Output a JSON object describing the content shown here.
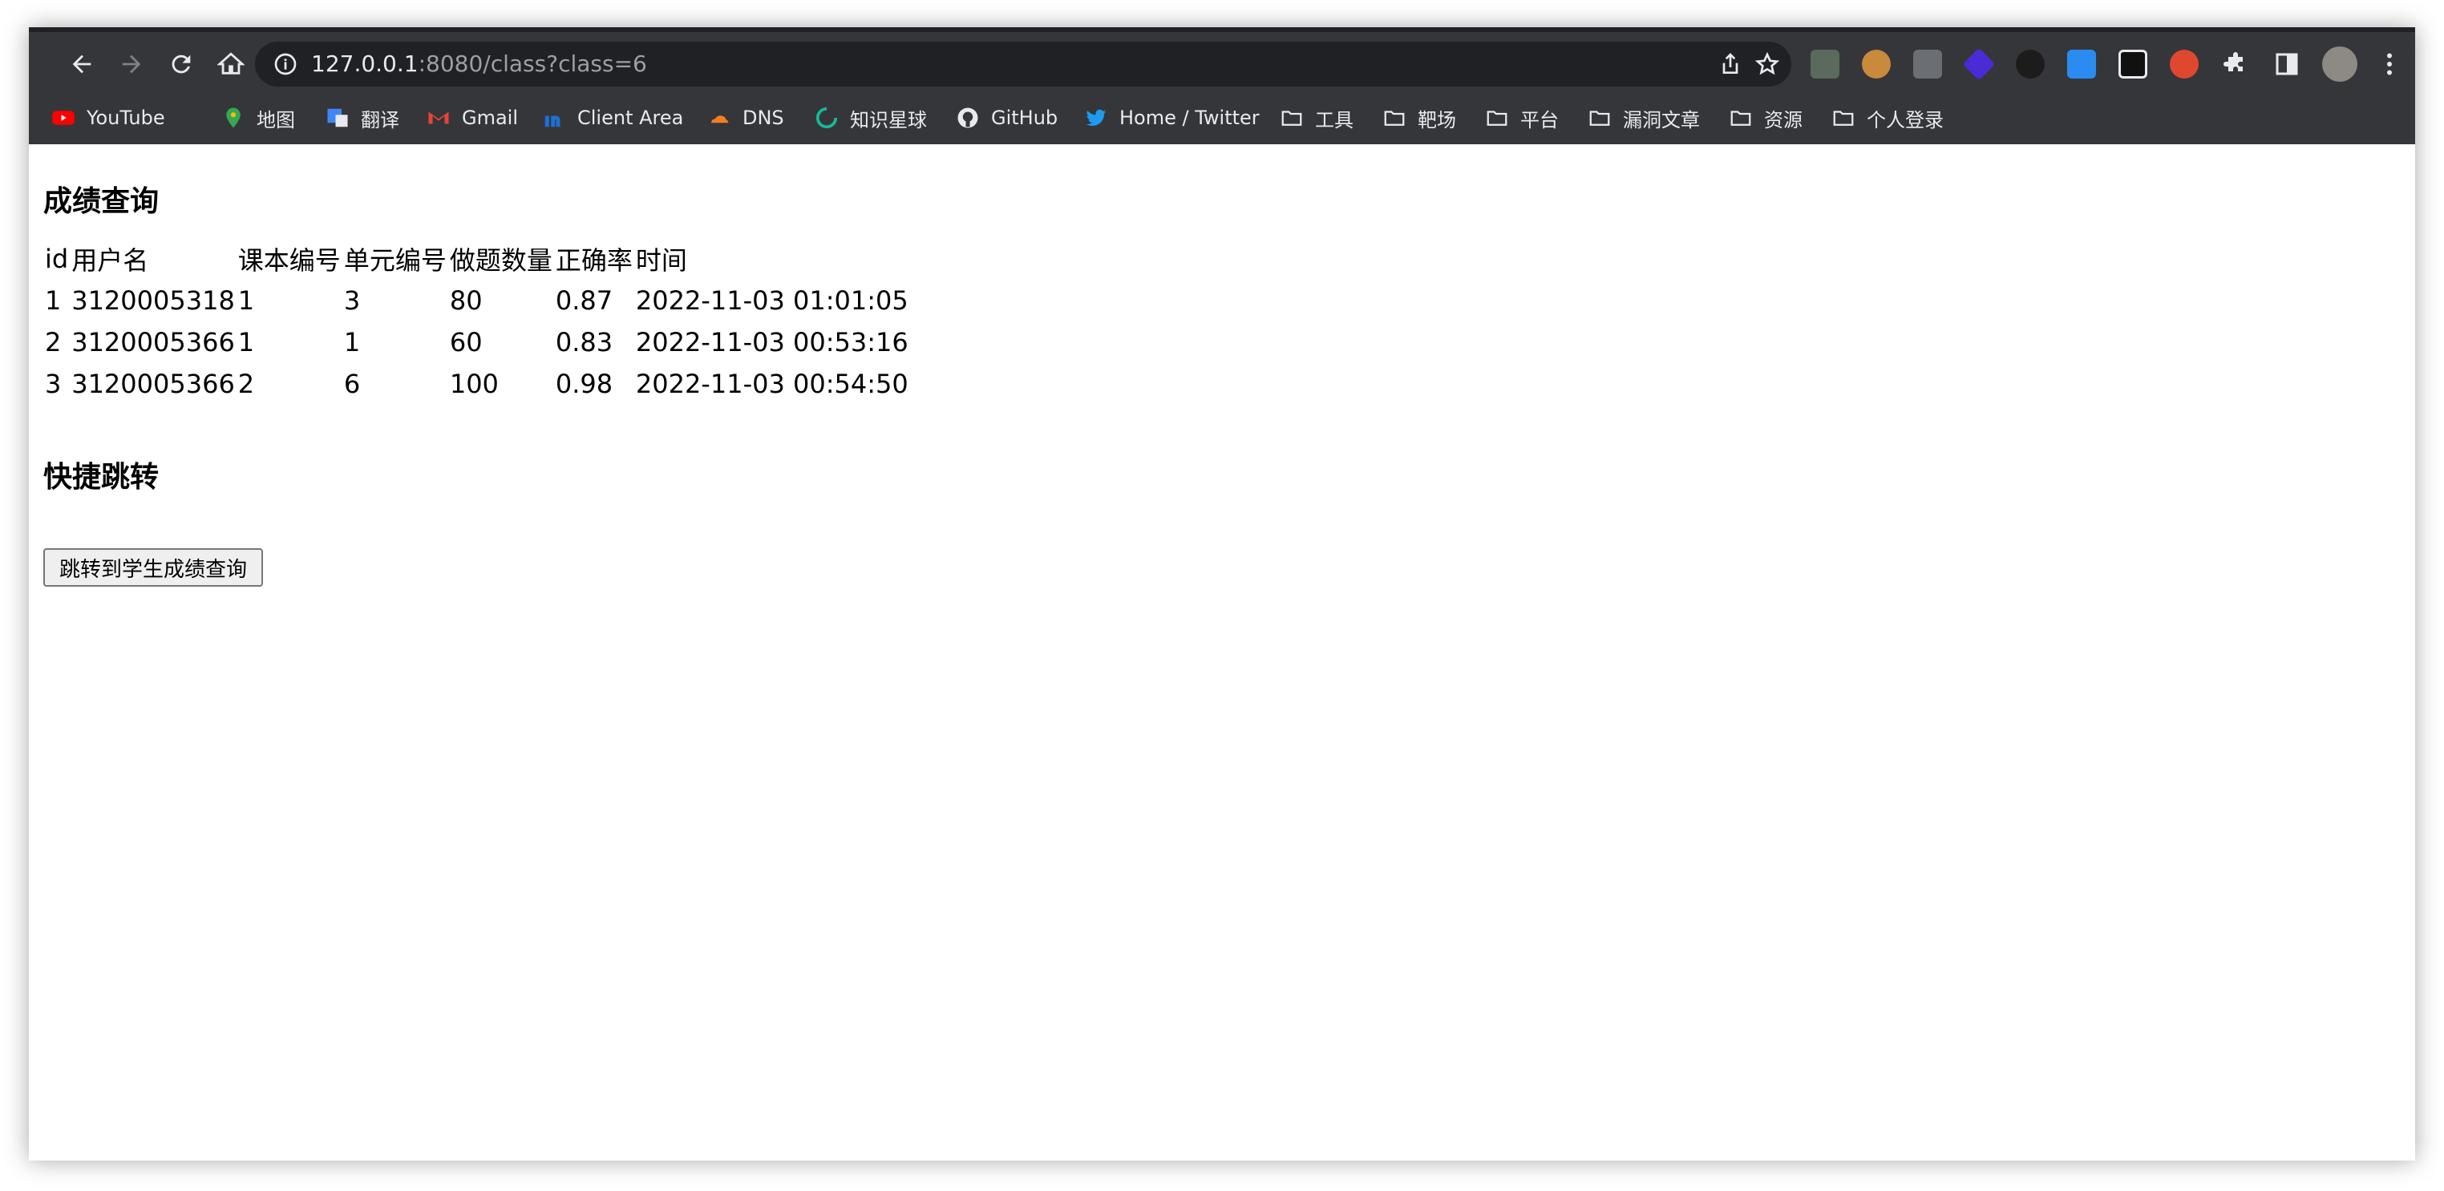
{
  "browser": {
    "url_host": "127.0.0.1",
    "url_path": ":8080/class?class=6",
    "extension_icons": [
      "puzzle-icon",
      "sidebar-icon"
    ],
    "bookmarks": [
      {
        "label": "YouTube",
        "icon": "youtube-icon"
      },
      {
        "label": "地图",
        "icon": "maps-icon"
      },
      {
        "label": "翻译",
        "icon": "translate-icon"
      },
      {
        "label": "Gmail",
        "icon": "gmail-icon"
      },
      {
        "label": "Client Area",
        "icon": "client-area-icon"
      },
      {
        "label": "DNS",
        "icon": "cloudflare-icon"
      },
      {
        "label": "知识星球",
        "icon": "zsxq-icon"
      },
      {
        "label": "GitHub",
        "icon": "github-icon"
      },
      {
        "label": "Home / Twitter",
        "icon": "twitter-icon"
      },
      {
        "label": "工具",
        "icon": "folder-icon"
      },
      {
        "label": "靶场",
        "icon": "folder-icon"
      },
      {
        "label": "平台",
        "icon": "folder-icon"
      },
      {
        "label": "漏洞文章",
        "icon": "folder-icon"
      },
      {
        "label": "资源",
        "icon": "folder-icon"
      },
      {
        "label": "个人登录",
        "icon": "folder-icon"
      }
    ]
  },
  "page": {
    "title": "成绩查询",
    "table": {
      "headers": [
        "id",
        "用户名",
        "课本编号",
        "单元编号",
        "做题数量",
        "正确率",
        "时间"
      ],
      "rows": [
        [
          "1",
          "3120005318",
          "1",
          "3",
          "80",
          "0.87",
          "2022-11-03 01:01:05"
        ],
        [
          "2",
          "3120005366",
          "1",
          "1",
          "60",
          "0.83",
          "2022-11-03 00:53:16"
        ],
        [
          "3",
          "3120005366",
          "2",
          "6",
          "100",
          "0.98",
          "2022-11-03 00:54:50"
        ]
      ]
    },
    "jump_title": "快捷跳转",
    "jump_button": "跳转到学生成绩查询"
  },
  "colors": {
    "toolbar_bg": "#35363a",
    "omnibox_bg": "#202124",
    "toolbar_text": "#e8eaed"
  }
}
